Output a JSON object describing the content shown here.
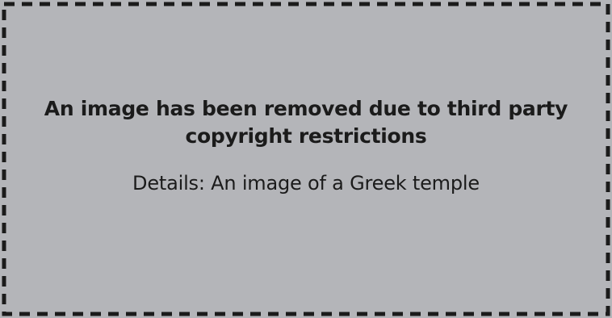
{
  "notice": {
    "headline_line1": "An image has been removed due to third party",
    "headline_line2": "copyright restrictions",
    "details": "Details: An image of a Greek temple"
  },
  "colors": {
    "background": "#b4b5b9",
    "border": "#1b1b1b",
    "text": "#1b1b1b"
  }
}
